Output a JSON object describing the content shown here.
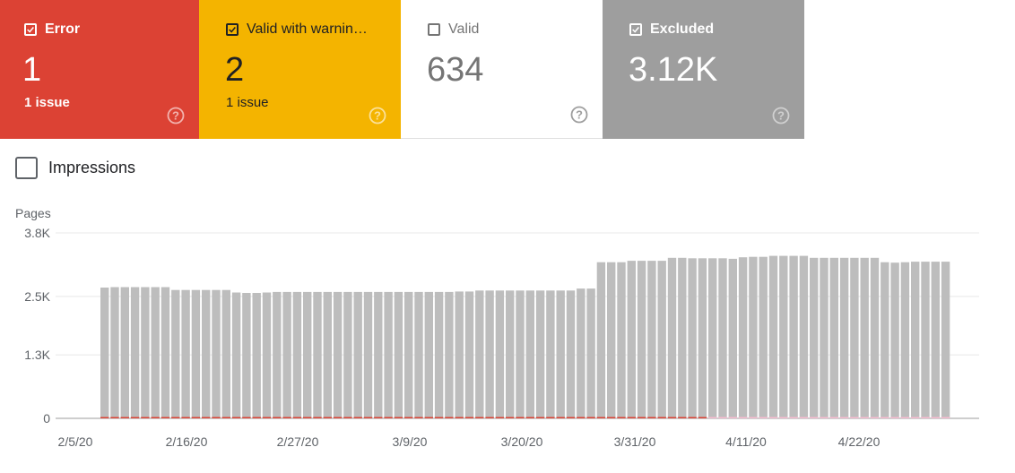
{
  "tiles": [
    {
      "id": "error",
      "label": "Error",
      "value": "1",
      "sub": "1 issue",
      "checked": true,
      "color": "#dc4234"
    },
    {
      "id": "warning",
      "label": "Valid with warnin…",
      "value": "2",
      "sub": "1 issue",
      "checked": true,
      "color": "#f4b400"
    },
    {
      "id": "valid",
      "label": "Valid",
      "value": "634",
      "sub": "",
      "checked": false,
      "color": "#ffffff"
    },
    {
      "id": "excluded",
      "label": "Excluded",
      "value": "3.12K",
      "sub": "",
      "checked": true,
      "color": "#9e9e9e"
    }
  ],
  "impressions": {
    "label": "Impressions",
    "checked": false
  },
  "chart_data": {
    "type": "bar",
    "ylabel": "Pages",
    "yticks": [
      "3.8K",
      "2.5K",
      "1.3K",
      "0"
    ],
    "ylim": [
      0,
      3800
    ],
    "xticks": [
      "2/5/20",
      "2/16/20",
      "2/27/20",
      "3/9/20",
      "3/20/20",
      "3/31/20",
      "4/11/20",
      "4/22/20"
    ],
    "bar_color": "#bdbdbd",
    "error_color": "#dc4234",
    "warning_color": "#f8bbd0",
    "series": [
      {
        "name": "Excluded",
        "values": [
          2680,
          2690,
          2690,
          2690,
          2690,
          2690,
          2690,
          2630,
          2630,
          2630,
          2630,
          2630,
          2630,
          2580,
          2570,
          2570,
          2580,
          2590,
          2590,
          2590,
          2590,
          2590,
          2590,
          2590,
          2590,
          2590,
          2590,
          2590,
          2590,
          2590,
          2590,
          2590,
          2590,
          2590,
          2590,
          2600,
          2600,
          2620,
          2620,
          2620,
          2620,
          2620,
          2620,
          2620,
          2620,
          2620,
          2620,
          2660,
          2660,
          3200,
          3200,
          3200,
          3230,
          3230,
          3230,
          3230,
          3290,
          3290,
          3280,
          3280,
          3280,
          3280,
          3270,
          3300,
          3310,
          3310,
          3330,
          3330,
          3330,
          3330,
          3290,
          3290,
          3290,
          3290,
          3290,
          3290,
          3290,
          3200,
          3190,
          3200,
          3210,
          3210,
          3210,
          3210
        ],
        "start": "2/8/20"
      },
      {
        "name": "Error",
        "values": [
          1
        ]
      },
      {
        "name": "Valid with warnings",
        "values": [
          2
        ]
      }
    ]
  }
}
